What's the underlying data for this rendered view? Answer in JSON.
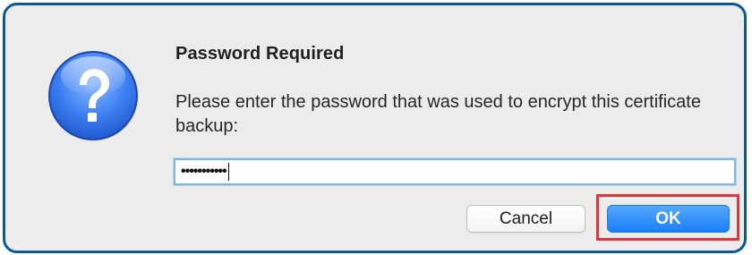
{
  "dialog": {
    "icon": "question-mark-icon",
    "title": "Password Required",
    "message": "Please enter the password that was used to encrypt this certificate backup:",
    "password_value": "•••••••••••",
    "cancel_label": "Cancel",
    "ok_label": "OK"
  },
  "colors": {
    "frame_border": "#0b5a93",
    "dialog_background": "#ececec",
    "ok_button": "#1a7ff6",
    "highlight_box": "#e0353c",
    "field_focus_ring": "#7fb3ea"
  }
}
